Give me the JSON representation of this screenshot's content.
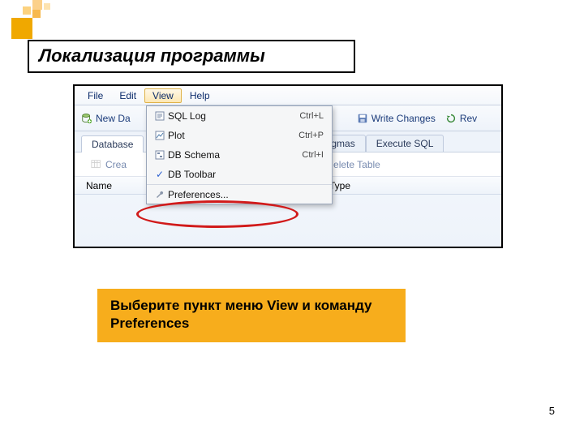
{
  "slide": {
    "title": "Локализация программы",
    "instruction": "Выберите пункт меню View и команду Preferences",
    "page_number": "5"
  },
  "menubar": {
    "items": [
      "File",
      "Edit",
      "View",
      "Help"
    ],
    "active_index": 2
  },
  "toolbar": {
    "new_db": "New Da",
    "write_changes": "Write Changes",
    "revert": "Rev"
  },
  "tabs": {
    "database_structure": "Database",
    "pragmas": "gmas",
    "execute_sql": "Execute SQL"
  },
  "subtoolbar": {
    "create": "Crea",
    "delete_table": "elete Table"
  },
  "columns": {
    "name": "Name",
    "type": "Type"
  },
  "dropdown": {
    "items": [
      {
        "icon": "log-icon",
        "label": "SQL Log",
        "shortcut": "Ctrl+L"
      },
      {
        "icon": "plot-icon",
        "label": "Plot",
        "shortcut": "Ctrl+P"
      },
      {
        "icon": "schema-icon",
        "label": "DB Schema",
        "shortcut": "Ctrl+I"
      },
      {
        "icon": "check-icon",
        "label": "DB Toolbar",
        "shortcut": ""
      },
      {
        "icon": "wrench-icon",
        "label": "Preferences...",
        "shortcut": ""
      }
    ]
  }
}
